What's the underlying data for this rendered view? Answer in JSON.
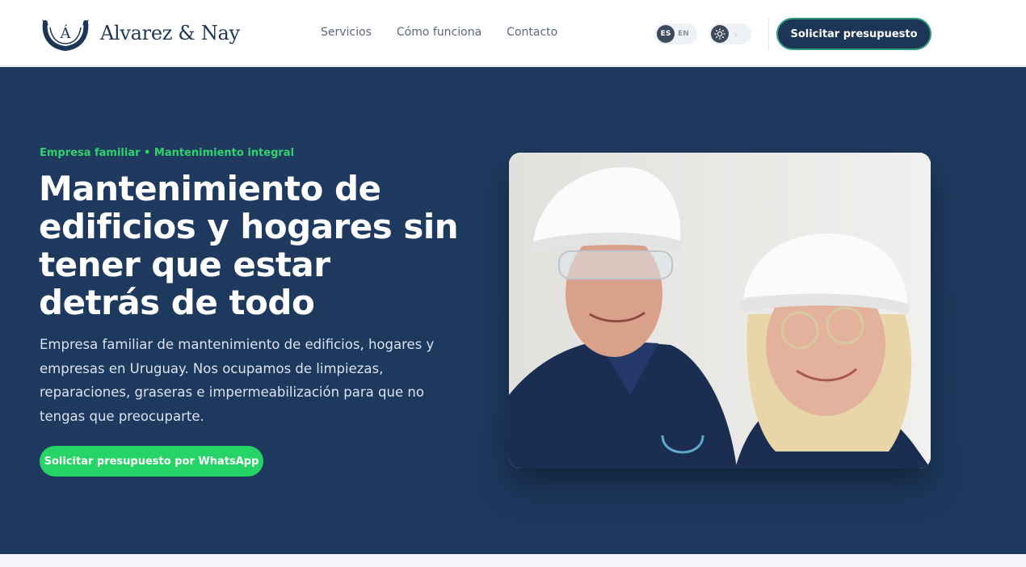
{
  "brand": {
    "name": "Alvarez & Nay",
    "emblem_letter": "Á",
    "emblem_caption": "ALVAREZ & NAY"
  },
  "nav": {
    "links": [
      "Servicios",
      "Cómo funciona",
      "Contacto"
    ]
  },
  "language": {
    "options": [
      "ES",
      "EN"
    ],
    "selected": "ES"
  },
  "theme": {
    "options": [
      "sun-icon",
      "moon-icon"
    ],
    "selected": "light"
  },
  "header_cta": "Solicitar presupuesto",
  "hero": {
    "eyebrow": "Empresa familiar • Mantenimiento integral",
    "title": "Mantenimiento de edificios y hogares sin tener que estar detrás de todo",
    "description": "Empresa familiar de mantenimiento de edificios, hogares y empresas en Uruguay. Nos ocupamos de limpiezas, reparaciones, graseras e impermeabilización para que no tengas que preocuparte.",
    "cta": "Solicitar presupuesto por WhatsApp"
  },
  "colors": {
    "brand_navy": "#1d3557",
    "hero_bg": "#203a5f",
    "accent_green": "#25d366",
    "eyebrow_green": "#2fd36b",
    "cta_border": "#2f9c7a"
  }
}
